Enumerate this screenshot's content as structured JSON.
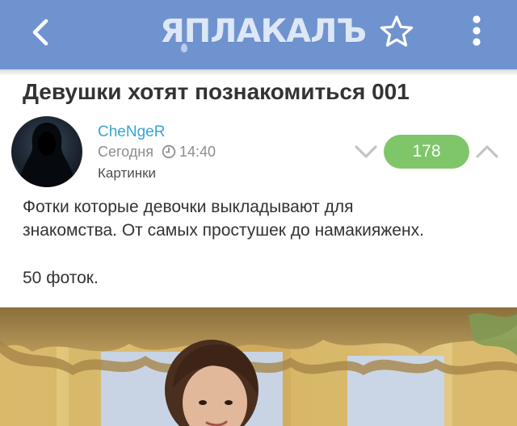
{
  "header": {
    "logo_text": "ЯПЛАКАЛЪ",
    "back_icon": "chevron-left-icon",
    "favorite_icon": "star-outline-icon",
    "menu_icon": "more-vertical-icon",
    "background_color": "#6f93cf"
  },
  "post": {
    "title": "Девушки хотят познакомиться 001",
    "author": "CheNgeR",
    "date": "Сегодня",
    "time": "14:40",
    "category": "Картинки",
    "rating": "178",
    "rating_color": "#7fc66a",
    "text_line1": "Фотки которые девочки выкладывают для",
    "text_line2": "знакомства. От самых простушек до намакияженх.",
    "count_text": "50 фоток."
  }
}
